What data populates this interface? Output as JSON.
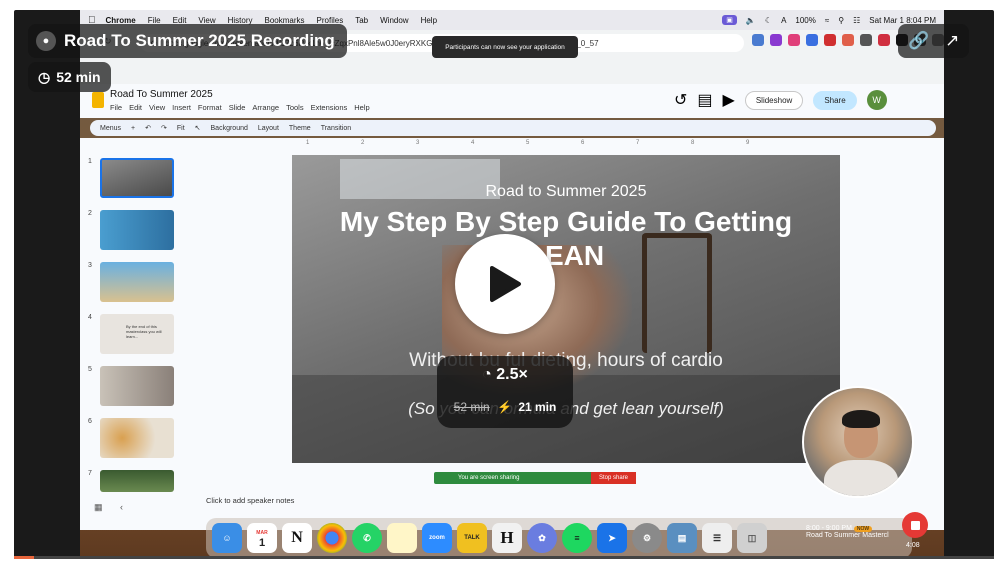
{
  "player": {
    "title": "Road To Summer 2025 Recording",
    "duration": "52 min",
    "speed": "2.5×",
    "original_time": "52 min",
    "fast_time": "21 min",
    "progress_fraction": 0.02,
    "record_time": "4:08"
  },
  "menubar": {
    "app": "Chrome",
    "items": [
      "File",
      "Edit",
      "View",
      "History",
      "Bookmarks",
      "Profiles",
      "Tab",
      "Window",
      "Help"
    ],
    "battery": "100%",
    "datetime": "Sat Mar 1  8:04 PM"
  },
  "notification": "Participants can now see your application",
  "browser": {
    "url": "docs.google.com/presentation/d/17b6R-k1h6_lcZqxPnl8Ale5w0J0eryRXKGZhg7vkF9w/edit#slide=id.g29493d93759_0_57"
  },
  "slides_app": {
    "doc_title": "Road To Summer 2025",
    "menu": [
      "File",
      "Edit",
      "View",
      "Insert",
      "Format",
      "Slide",
      "Arrange",
      "Tools",
      "Extensions",
      "Help"
    ],
    "slideshow_label": "Slideshow",
    "share_label": "Share",
    "avatar_letter": "W",
    "toolbar": [
      "Menus",
      "Fit",
      "Background",
      "Layout",
      "Theme",
      "Transition"
    ],
    "ruler": [
      "1",
      "2",
      "3",
      "4",
      "5",
      "6",
      "7",
      "8",
      "9"
    ],
    "thumbs": [
      {
        "num": "1"
      },
      {
        "num": "2"
      },
      {
        "num": "3"
      },
      {
        "num": "4",
        "text": "By the end of this masterclass you will learn..."
      },
      {
        "num": "5"
      },
      {
        "num": "6"
      },
      {
        "num": "7"
      }
    ],
    "speaker_notes": "Click to add speaker notes"
  },
  "slide": {
    "subtitle": "Road to Summer 2025",
    "title_line1": "My Step By Step Guide To Getting",
    "title_line2": "LEAN",
    "line1": "Without bu                      ful dieting, hours of cardio",
    "line2": "(So you can                            ormula and get lean yourself)"
  },
  "share_bar": {
    "text": "You are screen sharing",
    "stop": "Stop share"
  },
  "dock": {
    "calendar_day": "1",
    "calendar_month": "MAR",
    "apps": [
      "finder",
      "calendar",
      "notion",
      "chrome",
      "whatsapp",
      "notes",
      "zoom",
      "talk",
      "hemingway",
      "settings-flower",
      "spotify",
      "prime",
      "system-prefs",
      "preview",
      "files",
      "trash"
    ],
    "event_time": "8:00 - 9:00 PM",
    "event_badge": "NOW",
    "event_title": "Road To Summer Mastercl"
  },
  "colors": {
    "accent_record": "#e53935",
    "share_green": "#2e8b3e",
    "share_button": "#c2e7ff",
    "bolt": "#f5c518"
  }
}
